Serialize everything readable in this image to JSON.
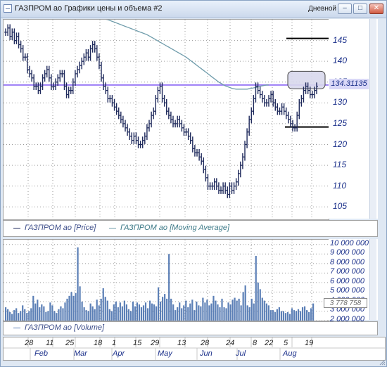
{
  "window": {
    "title": "ГАЗПРОМ ао Графики цены и объема #2",
    "period": "Дневной",
    "buttons": {
      "minimize": "–",
      "maximize": "□",
      "restore": "❐",
      "close": "✕"
    }
  },
  "colors": {
    "price": "#1f2a5c",
    "ma": "#6f9cab",
    "level": "#9b7cf6",
    "volume": "#5b7fb6"
  },
  "price_axis": {
    "ticks": [
      "145",
      "140",
      "135",
      "130",
      "125",
      "120",
      "115",
      "110",
      "105"
    ],
    "current": "134.31135"
  },
  "volume_axis": {
    "ticks": [
      "10 000 000",
      "9 000 000",
      "8 000 000",
      "7 000 000",
      "6 000 000",
      "5 000 000",
      "4 000 000",
      "3 000 000",
      "2 000 000"
    ],
    "current": "3 778 758"
  },
  "legend": {
    "price": "ГАЗПРОМ ао [Price]",
    "ma": "ГАЗПРОМ ао [Moving Average]",
    "volume": "ГАЗПРОМ ао [Volume]"
  },
  "dates": {
    "days": [
      "28",
      "11",
      "25",
      "18",
      "1",
      "15",
      "29",
      "13",
      "28",
      "24",
      "8",
      "22",
      "5",
      "19"
    ],
    "months": [
      "Feb",
      "Mar",
      "Apr",
      "May",
      "Jun",
      "Jul",
      "Aug"
    ]
  },
  "chart_data": [
    {
      "type": "line",
      "ylim": [
        102,
        150
      ],
      "series": [
        {
          "name": "ГАЗПРОМ ао [Price]",
          "values": [
            147,
            148,
            146,
            147,
            145,
            146,
            144,
            143,
            141,
            141,
            138,
            137,
            136,
            134,
            134,
            133,
            134,
            136,
            137,
            138,
            136,
            134,
            134,
            135,
            136,
            137,
            137,
            134,
            132,
            133,
            133,
            135,
            137,
            138,
            139,
            140,
            141,
            142,
            141,
            143,
            144,
            143,
            141,
            139,
            136,
            134,
            133,
            131,
            131,
            130,
            129,
            128,
            127,
            126,
            125,
            124,
            123,
            122,
            121,
            122,
            121,
            120,
            120,
            121,
            122,
            124,
            125,
            127,
            128,
            131,
            133,
            134,
            131,
            130,
            128,
            127,
            126,
            125,
            125,
            126,
            125,
            124,
            123,
            123,
            122,
            121,
            119,
            118,
            118,
            117,
            116,
            114,
            112,
            110,
            110,
            110,
            111,
            110,
            109,
            109,
            110,
            109,
            108,
            110,
            109,
            110,
            111,
            113,
            115,
            117,
            120,
            123,
            126,
            128,
            131,
            134,
            133,
            132,
            131,
            130,
            130,
            131,
            132,
            130,
            129,
            128,
            128,
            129,
            128,
            127,
            126,
            125,
            124,
            124,
            127,
            130,
            131,
            133,
            134,
            133,
            132,
            132,
            133,
            134
          ]
        },
        {
          "name": "ГАЗПРОМ ао [Moving Average]",
          "values": [
            null,
            null,
            null,
            null,
            null,
            null,
            null,
            null,
            null,
            null,
            null,
            null,
            null,
            null,
            null,
            null,
            null,
            null,
            null,
            null,
            null,
            null,
            null,
            null,
            null,
            null,
            null,
            null,
            null,
            null,
            null,
            null,
            null,
            null,
            null,
            null,
            null,
            null,
            null,
            null,
            null,
            null,
            null,
            null,
            null,
            null,
            150.1,
            150,
            149.8,
            149.6,
            149.4,
            149.2,
            149,
            148.8,
            148.6,
            148.4,
            148.2,
            148,
            147.8,
            147.6,
            147.4,
            147.2,
            147,
            146.8,
            146.6,
            146.4,
            146.1,
            145.8,
            145.5,
            145.2,
            144.9,
            144.6,
            144.3,
            144,
            143.7,
            143.4,
            143.1,
            142.8,
            142.5,
            142.2,
            141.9,
            141.6,
            141.3,
            141,
            140.6,
            140.2,
            139.8,
            139.4,
            139,
            138.6,
            138.2,
            137.8,
            137.4,
            137,
            136.6,
            136.2,
            135.8,
            135.4,
            135,
            134.7,
            134.4,
            134.1,
            133.9,
            133.7,
            133.5,
            133.4,
            133.3,
            133.3,
            133.3,
            133.3,
            133.3,
            133.3,
            133.4,
            133.5,
            133.6,
            133.7,
            133.8,
            134,
            134.1,
            134.2,
            134.3,
            134.3
          ]
        }
      ],
      "annotations": {
        "horizontal_level": 134.31,
        "upper_line": 145.5,
        "lower_line": 124.2
      }
    },
    {
      "type": "bar",
      "title": "Volume",
      "ylim": [
        2000000,
        10500000
      ],
      "series": [
        {
          "name": "ГАЗПРОМ ао [Volume]",
          "values": [
            3400000,
            3200000,
            2900000,
            2700000,
            3100000,
            3300000,
            2800000,
            3000000,
            3600000,
            3200000,
            2800000,
            3000000,
            3300000,
            4600000,
            3800000,
            4200000,
            3400000,
            3700000,
            3500000,
            2900000,
            3000000,
            3900000,
            3600000,
            3000000,
            2800000,
            3200000,
            3500000,
            3300000,
            3900000,
            4300000,
            4600000,
            5000000,
            4600000,
            4900000,
            9700000,
            5600000,
            4000000,
            3400000,
            3100000,
            3000000,
            3800000,
            3500000,
            3200000,
            4200000,
            3600000,
            4300000,
            5400000,
            4500000,
            4100000,
            3200000,
            3000000,
            3700000,
            4000000,
            3400000,
            3900000,
            3500000,
            4100000,
            3700000,
            3200000,
            3000000,
            4000000,
            3500000,
            3900000,
            3700000,
            3400000,
            3600000,
            3900000,
            3300000,
            4100000,
            3800000,
            3700000,
            3500000,
            5500000,
            4000000,
            4500000,
            4800000,
            4300000,
            9000000,
            4300000,
            3700000,
            3100000,
            3400000,
            3900000,
            3300000,
            3600000,
            4100000,
            3400000,
            3800000,
            4200000,
            3100000,
            4000000,
            3600000,
            3500000,
            4400000,
            3900000,
            4200000,
            3600000,
            3800000,
            4600000,
            4100000,
            3700000,
            3400000,
            4300000,
            3400000,
            3300000,
            3900000,
            3700000,
            4200000,
            4400000,
            4100000,
            4300000,
            3600000,
            5000000,
            5700000,
            3600000,
            3400000,
            4300000,
            3800000,
            8800000,
            6000000,
            5300000,
            4400000,
            4100000,
            3800000,
            3600000,
            3100000,
            3100000,
            2900000,
            3200000,
            3400000,
            3000000,
            3000000,
            2800000,
            2900000,
            2700000,
            3300000,
            3100000,
            3000000,
            3200000,
            3000000,
            3400000,
            3500000,
            3100000,
            2900000,
            3300000,
            3800000
          ]
        }
      ]
    }
  ]
}
